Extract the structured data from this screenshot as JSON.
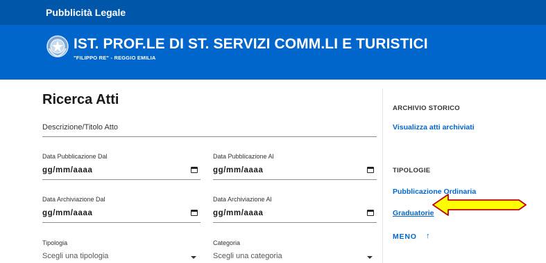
{
  "topbar": {
    "title": "Pubblicità Legale"
  },
  "header": {
    "school_name": "IST. PROF.LE DI ST. SERVIZI COMM.LI E TURISTICI",
    "school_subtitle": "\"FILIPPO RE\" - REGGIO EMILIA",
    "emblem_icon": "italian-republic-emblem-icon"
  },
  "search": {
    "title": "Ricerca Atti",
    "description_placeholder": "Descrizione/Titolo Atto",
    "pub_from_label": "Data Pubblicazione Dal",
    "pub_to_label": "Data Pubblicazione Al",
    "arch_from_label": "Data Archiviazione Dal",
    "arch_to_label": "Data Archiviazione Al",
    "date_placeholder": "gg/mm/aaaa",
    "tipologia_label": "Tipologia",
    "tipologia_placeholder": "Scegli una tipologia",
    "categoria_label": "Categoria",
    "categoria_placeholder": "Scegli una categoria"
  },
  "sidebar": {
    "archive_heading": "ARCHIVIO STORICO",
    "archive_link": "Visualizza atti archiviati",
    "types_heading": "TIPOLOGIE",
    "items": [
      {
        "label": "Pubblicazione Ordinaria"
      },
      {
        "label": "Graduatorie"
      }
    ],
    "less_label": "MENO",
    "less_icon": "arrow-up-icon"
  },
  "colors": {
    "topbar_strip": "#0056a9",
    "header_bg": "#0066cc",
    "link": "#0066cc",
    "annotation_arrow_fill": "#ffff00",
    "annotation_arrow_stroke": "#c00000"
  }
}
